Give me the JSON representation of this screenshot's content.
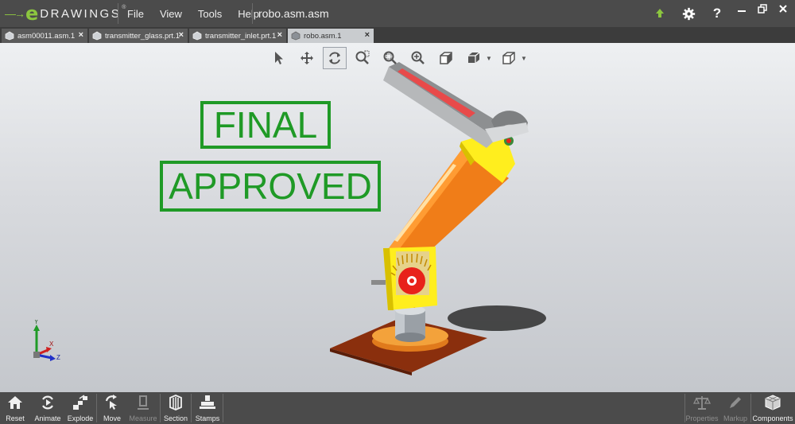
{
  "app": {
    "logo_letter": "e",
    "logo_word": "DRAWINGS",
    "logo_tm": "®",
    "document_title": "robo.asm.asm"
  },
  "menu": [
    "File",
    "View",
    "Tools",
    "Help"
  ],
  "title_icons": [
    "upload-icon",
    "gear-icon",
    "help-icon"
  ],
  "window_controls": [
    "minimize",
    "restore",
    "close"
  ],
  "tabs": [
    {
      "label": "asm00011.asm.1",
      "active": false
    },
    {
      "label": "transmitter_glass.prt.1",
      "active": false
    },
    {
      "label": "transmitter_inlet.prt.1",
      "active": false
    },
    {
      "label": "robo.asm.1",
      "active": true
    }
  ],
  "view_toolbar": [
    "select-arrow-icon",
    "pan-icon",
    "rotate-icon",
    "zoom-to-area-icon",
    "zoom-to-fit-icon",
    "zoom-in-out-icon",
    "shaded-display-icon",
    "view-orientation-icon",
    "standard-views-icon"
  ],
  "stamps": {
    "final": "FINAL",
    "approved": "APPROVED",
    "color": "#1f9a26"
  },
  "triad": {
    "x": "X",
    "y": "Y",
    "z": "Z"
  },
  "bottom_toolbar": {
    "left": [
      {
        "label": "Reset",
        "icon": "home-icon",
        "enabled": true
      },
      {
        "label": "Animate",
        "icon": "animate-icon",
        "enabled": true
      },
      {
        "label": "Explode",
        "icon": "explode-icon",
        "enabled": true
      },
      {
        "label": "Move",
        "icon": "move-icon",
        "enabled": true
      },
      {
        "label": "Measure",
        "icon": "measure-icon",
        "enabled": false
      },
      {
        "label": "Section",
        "icon": "section-icon",
        "enabled": true
      },
      {
        "label": "Stamps",
        "icon": "stamps-icon",
        "enabled": true
      }
    ],
    "right": [
      {
        "label": "Properties",
        "icon": "scales-icon",
        "enabled": false
      },
      {
        "label": "Markup",
        "icon": "pen-icon",
        "enabled": false
      },
      {
        "label": "Components",
        "icon": "components-icon",
        "enabled": true
      }
    ]
  },
  "colors": {
    "accent": "#8cc63f",
    "titlebar": "#4b4b4b",
    "tab_active": "#c9cccf"
  }
}
